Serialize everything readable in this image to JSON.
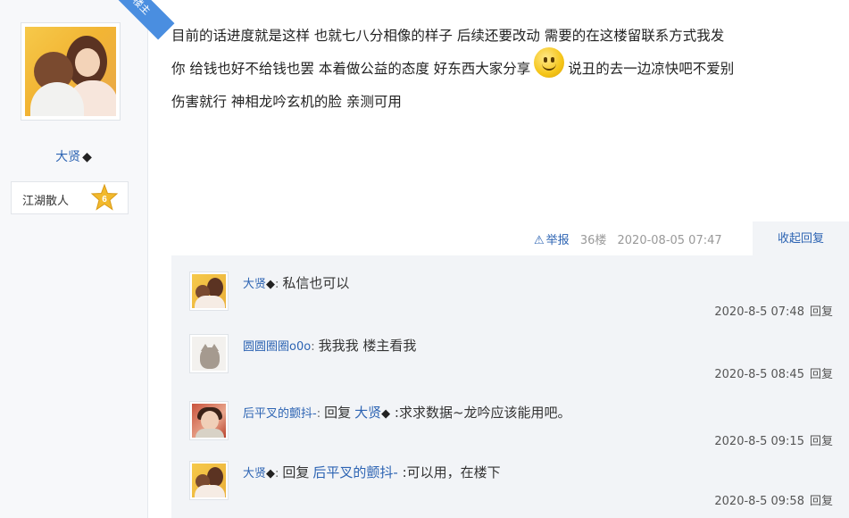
{
  "author": {
    "badge": "楼主",
    "username": "大贤",
    "diamond": "◆",
    "rank_title": "江湖散人",
    "rank_level": "6"
  },
  "post": {
    "lines": [
      "目前的话进度就是这样 也就七八分相像的样子 后续还要改动 需要的在这楼留联系方式我发",
      "你 给钱也好不给钱也罢 本着做公益的态度 好东西大家分享",
      "说丑的去一边凉快吧不爱别",
      "伤害就行 神相龙吟玄机的脸 亲测可用"
    ],
    "emoji": "smile-emoji"
  },
  "meta": {
    "report": "举报",
    "floor": "36楼",
    "time": "2020-08-05 07:47",
    "collapse": "收起回复"
  },
  "replies": [
    {
      "avatar": "couple",
      "user": "大贤",
      "diamond": "◆",
      "ref_word": "",
      "ref_user": "",
      "ref_diamond": "",
      "text": "私信也可以",
      "time": "2020-8-5 07:48",
      "action": "回复"
    },
    {
      "avatar": "cat",
      "user": "圆圆圈圈o0o",
      "diamond": "",
      "ref_word": "",
      "ref_user": "",
      "ref_diamond": "",
      "text": "我我我 楼主看我",
      "time": "2020-8-5 08:45",
      "action": "回复"
    },
    {
      "avatar": "girl",
      "user": "后平叉的颤抖-",
      "diamond": "",
      "ref_word": "回复",
      "ref_user": "大贤",
      "ref_diamond": "◆",
      "text": ":求求数据~龙吟应该能用吧。",
      "time": "2020-8-5 09:15",
      "action": "回复"
    },
    {
      "avatar": "couple",
      "user": "大贤",
      "diamond": "◆",
      "ref_word": "回复",
      "ref_user": "后平叉的颤抖-",
      "ref_diamond": "",
      "text": ":可以用，在楼下",
      "time": "2020-8-5 09:58",
      "action": "回复"
    }
  ],
  "colors": {
    "link": "#2d64b3",
    "panel": "#f2f4f7",
    "badge": "#4a8ee0"
  }
}
